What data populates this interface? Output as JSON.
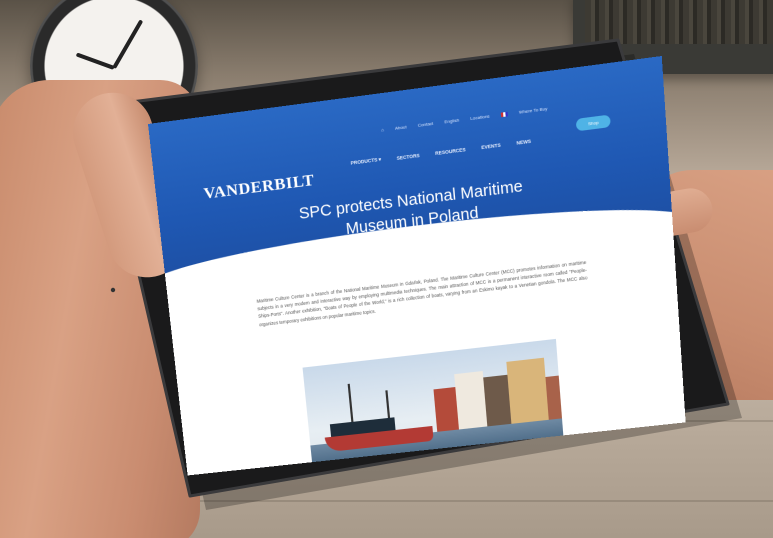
{
  "scene": {
    "description_layer": "",
    "tablet_page": {
      "top_nav": {
        "items": [
          "About",
          "Contact",
          "English",
          "Locations",
          "Where To Buy"
        ]
      },
      "brand": {
        "logo_text": "VANDERBILT"
      },
      "main_nav": {
        "items": [
          "PRODUCTS ▾",
          "SECTORS",
          "RESOURCES",
          "EVENTS",
          "NEWS"
        ],
        "shop_label": "Shop"
      },
      "hero": {
        "title_line1": "SPC protects National Maritime",
        "title_line2": "Museum in Poland"
      },
      "article": {
        "paragraph": "Maritime Culture Center is a branch of the National Maritime Museum in Gdańsk, Poland. The Maritime Culture Center (MCC) promotes information on maritime subjects in a very modern and interactive way by employing multimedia techniques. The main attraction of MCC is a permanent interactive room called \"People-Ships-Ports\". Another exhibition, \"Boats of People of the World,\" is a rich collection of boats, varying from an Eskimo kayak to a Venetian gondola. The MCC also organizes temporary exhibitions on popular maritime topics."
      }
    }
  }
}
